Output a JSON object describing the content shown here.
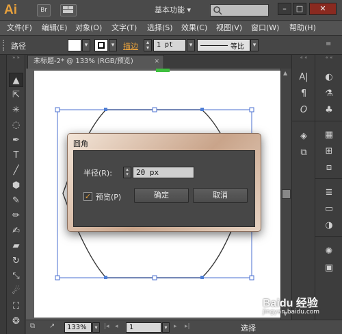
{
  "app": {
    "logo": "Ai",
    "bridge_label": "Br",
    "workspace": "基本功能",
    "workspace_arrow": "▾",
    "search_placeholder": ""
  },
  "window_controls": {
    "minimize": "–",
    "maximize": "□",
    "close": "✕"
  },
  "menubar": [
    "文件(F)",
    "编辑(E)",
    "对象(O)",
    "文字(T)",
    "选择(S)",
    "效果(C)",
    "视图(V)",
    "窗口(W)",
    "帮助(H)"
  ],
  "controlbar": {
    "context_label": "路径",
    "stroke_link": "描边",
    "stroke_weight": "1 pt",
    "stroke_profile": "等比",
    "dropdown_arrow": "▾"
  },
  "document_tab": {
    "title": "未标题-2* @ 133% (RGB/预览)",
    "close": "✕"
  },
  "toolbar_icons": [
    "selection-tool-icon",
    "direct-selection-tool-icon",
    "magic-wand-tool-icon",
    "lasso-tool-icon",
    "pen-tool-icon",
    "type-tool-icon",
    "line-tool-icon",
    "polygon-tool-icon",
    "paintbrush-tool-icon",
    "pencil-tool-icon",
    "blob-brush-tool-icon",
    "eraser-tool-icon",
    "rotate-tool-icon",
    "scale-tool-icon",
    "warp-tool-icon",
    "free-transform-tool-icon",
    "symbol-sprayer-tool-icon"
  ],
  "dialog": {
    "title": "圆角",
    "radius_label": "半径(R):",
    "radius_value": "20 px",
    "preview_label": "预览(P)",
    "preview_checked": true,
    "ok_label": "确定",
    "cancel_label": "取消"
  },
  "statusbar": {
    "zoom": "133%",
    "page": "1",
    "status_text": "选择"
  },
  "watermark": {
    "brand": "Baidu 经验",
    "url": "jingyan.baidu.com"
  },
  "colors": {
    "accent": "#e8a13c",
    "selection": "#4f7fd6",
    "bounding_box": "#4a6fd0",
    "artboard": "#ffffff"
  }
}
